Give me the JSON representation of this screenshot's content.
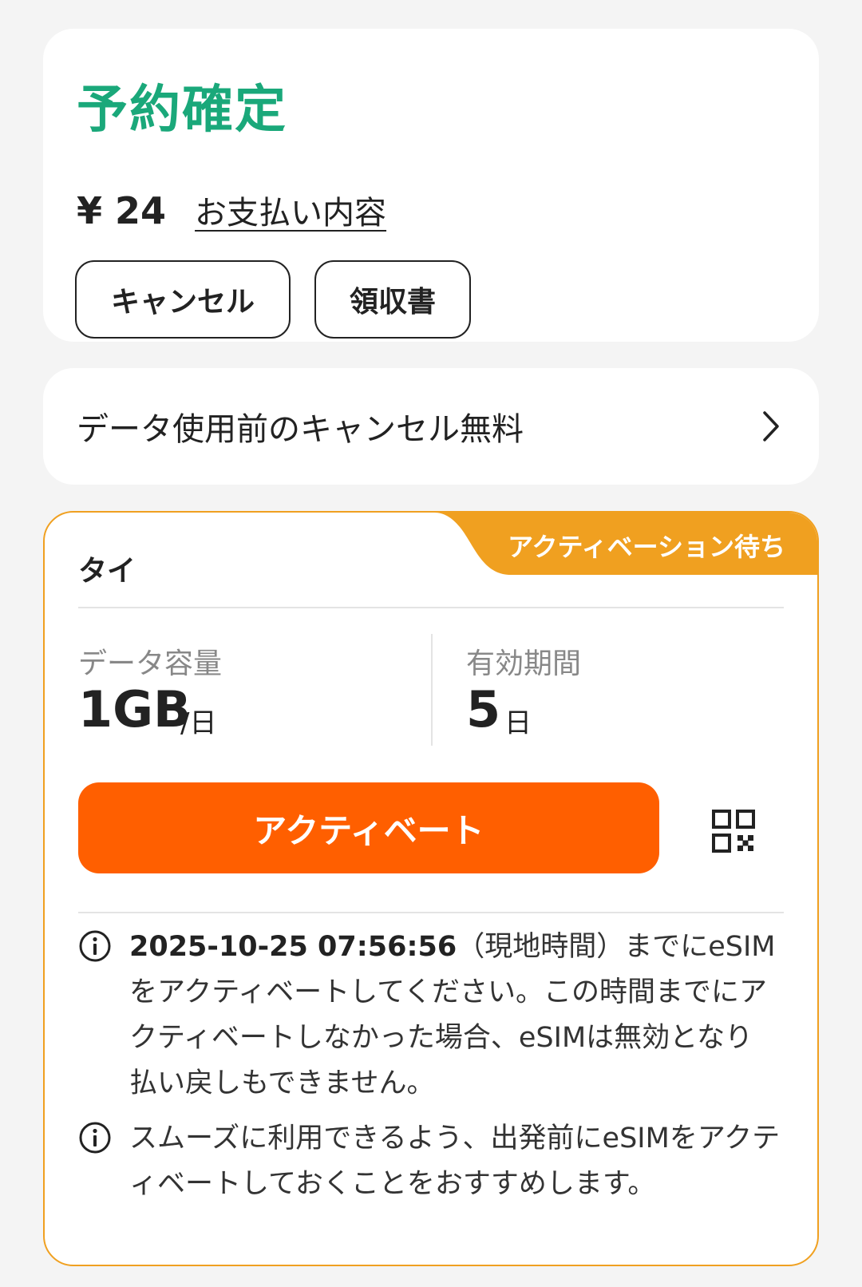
{
  "booking": {
    "status": "予約確定",
    "price": "¥ 24",
    "payment_details_link": "お支払い内容",
    "cancel_button": "キャンセル",
    "receipt_button": "領収書"
  },
  "policy": {
    "label": "データ使用前のキャンセル無料"
  },
  "esim": {
    "status_tab": "アクティベーション待ち",
    "country": "タイ",
    "data_label": "データ容量",
    "data_value": "1GB",
    "data_unit": "/日",
    "validity_label": "有効期間",
    "validity_value": "5",
    "validity_unit": "日",
    "activate_button": "アクティベート",
    "qr_icon": "qr-code-icon",
    "note1_deadline": "2025-10-25 07:56:56",
    "note1_text": "（現地時間）までにeSIMをアクティベートしてください。この時間までにアクティベートしなかった場合、eSIMは無効となり払い戻しもできません。",
    "note2_text": "スムーズに利用できるよう、出発前にeSIMをアクティベートしておくことをおすすめします。"
  },
  "colors": {
    "status_green": "#1aa87a",
    "accent_orange": "#ff5f00",
    "tab_orange": "#f0a020"
  }
}
